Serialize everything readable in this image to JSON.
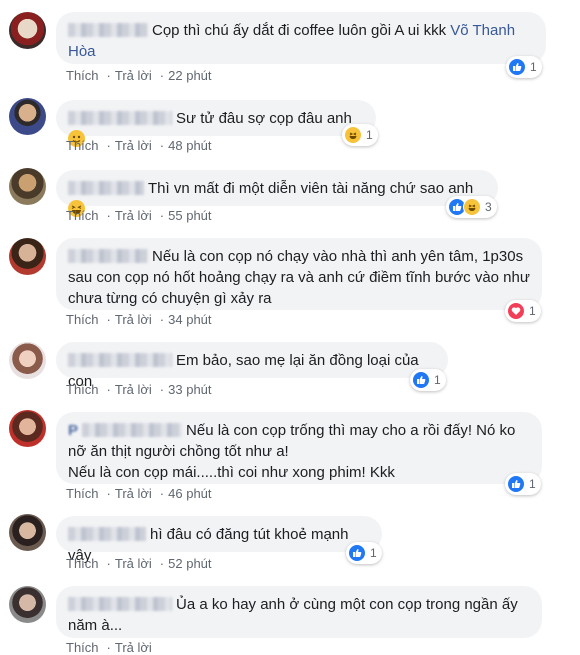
{
  "comments": [
    {
      "name_placeholder": "",
      "text": "Cọp thì chú ấy dắt đi coffee luôn gồi A ui kkk",
      "mention": "Võ Thanh Hòa",
      "like_label": "Thích",
      "reply_label": "Trả lời",
      "time": "22 phút",
      "reaction_count": "1",
      "reactions": [
        "like-icon"
      ]
    },
    {
      "text": "Sư tử đâu sợ cọp đâu anh",
      "like_label": "Thích",
      "reply_label": "Trả lời",
      "time": "48 phút",
      "reaction_count": "1",
      "reactions": [
        "haha-icon"
      ]
    },
    {
      "text": "Thì vn mất đi một diễn viên tài năng chứ sao anh",
      "like_label": "Thích",
      "reply_label": "Trả lời",
      "time": "55 phút",
      "reaction_count": "3",
      "reactions": [
        "like-icon",
        "haha-icon"
      ]
    },
    {
      "text": "Nếu là con cọp nó chạy vào nhà thì anh yên tâm, 1p30s sau con cọp nó hốt hoảng chạy ra và anh cứ điềm tĩnh bước vào như chưa từng có chuyện gì xảy ra",
      "like_label": "Thích",
      "reply_label": "Trả lời",
      "time": "34 phút",
      "reaction_count": "1",
      "reactions": [
        "love-icon"
      ]
    },
    {
      "text": "Em bảo, sao mẹ lại ăn đồng loại của con",
      "like_label": "Thích",
      "reply_label": "Trả lời",
      "time": "33 phút",
      "reaction_count": "1",
      "reactions": [
        "like-icon"
      ]
    },
    {
      "name_visible": "P",
      "text_line1": "Nếu là con cọp trống thì may cho a rồi đấy! Nó ko nỡ ăn thịt người chồng tốt như a!",
      "text_line2": "Nếu là con cọp mái.....thì coi như xong phim! Kkk",
      "like_label": "Thích",
      "reply_label": "Trả lời",
      "time": "46 phút",
      "reaction_count": "1",
      "reactions": [
        "like-icon"
      ]
    },
    {
      "text": "hì đâu có đăng tút khoẻ mạnh vậy",
      "like_label": "Thích",
      "reply_label": "Trả lời",
      "time": "52 phút",
      "reaction_count": "1",
      "reactions": [
        "like-icon"
      ]
    },
    {
      "text": "Ủa a ko hay anh ở cùng một con cọp trong ngần ấy năm à...",
      "like_label": "Thích",
      "reply_label": "Trả lời",
      "time": ""
    }
  ]
}
